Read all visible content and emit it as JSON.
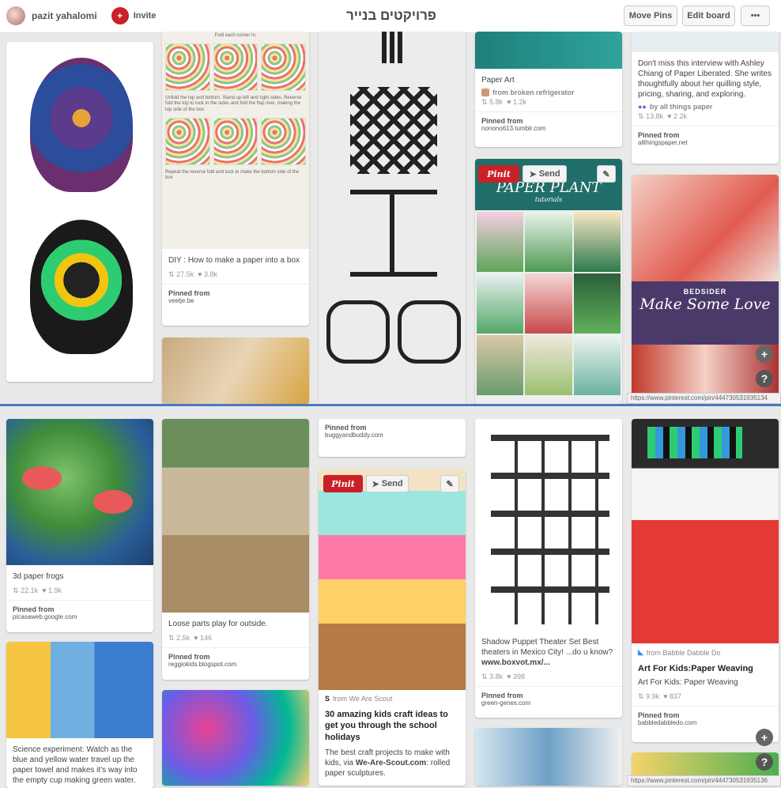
{
  "header": {
    "username": "pazit yahalomi",
    "invite_label": "Invite",
    "board_title": "פרויקטים בנייר",
    "move_pins_label": "Move Pins",
    "edit_board_label": "Edit board",
    "more_label": "•••"
  },
  "pins": [
    {
      "desc": "DIY : How to make a paper into a box",
      "repins": "27.5k",
      "likes": "3.8k",
      "from_label": "Pinned from",
      "source": "veetje.be",
      "fold1": "Fold each corner in.",
      "fold2": "Unfold the top and bottom. Stand up left and right sides. Reverse fold the top to tuck in the sides and fold the flap over, making the top side of the box",
      "fold3": "Repeat the reverse fold and tuck to make the bottom side of the box"
    },
    {
      "desc": "Paper Art",
      "attrib": "from broken refrigerator",
      "repins": "5.8k",
      "likes": "1.2k",
      "from_label": "Pinned from",
      "source": "nonono613.tumblr.com"
    },
    {
      "desc": "Don't miss this interview with Ashley Chiang of Paper Liberated. She writes thoughtfully about her quilling style, pricing, sharing, and exploring.",
      "attrib": "by all things paper",
      "repins": "13.8k",
      "likes": "2.2k",
      "from_label": "Pinned from",
      "source": "allthingspaper.net"
    },
    {
      "pinit": "Pinit",
      "send": "Send",
      "banner": "PAPER PLANT",
      "banner_sub": "tutorials"
    },
    {
      "banner_top": "BEDSIDER",
      "banner": "Make Some Love"
    },
    {
      "desc": "3d paper frogs",
      "repins": "22.1k",
      "likes": "1.9k",
      "from_label": "Pinned from",
      "source": "picasaweb.google.com"
    },
    {
      "desc": "Loose parts play for outside.",
      "repins": "2.5k",
      "likes": "146",
      "from_label": "Pinned from",
      "source": "reggiokids.blogspot.com"
    },
    {
      "from_label": "Pinned from",
      "source": "buggyandbuddy.com"
    },
    {
      "pinit": "Pinit",
      "send": "Send",
      "attrib": "from We Are Scout",
      "title": "30 amazing kids craft ideas to get you through the school holidays",
      "desc_pre": "The best craft projects to make with kids, via ",
      "desc_bold": "We-Are-Scout.com",
      "desc_post": ": rolled paper sculptures."
    },
    {
      "desc_pre": "Shadow Puppet Theater Set Best theaters in Mexico City! ...do u know? ",
      "desc_bold": "www.boxvot.mx/...",
      "repins": "3.8k",
      "likes": "398",
      "from_label": "Pinned from",
      "source": "green-genes.com"
    },
    {
      "attrib": "from Babble Dabble Do",
      "title": "Art For Kids:Paper Weaving",
      "desc": "Art For Kids: Paper Weaving",
      "repins": "9.9k",
      "likes": "837",
      "from_label": "Pinned from",
      "source": "babbledabbledo.com"
    },
    {
      "desc": "Science experiment: Watch as the blue and yellow water travel up the paper towel and makes it's way into the empty cup making green water."
    }
  ],
  "status_url_1": "https://www.pinterest.com/pin/444730531935134",
  "status_url_2": "https://www.pinterest.com/pin/444730531935136",
  "fab_plus": "+",
  "fab_help": "?",
  "repin_icon": "⇅",
  "like_icon": "♥",
  "colors": {
    "brand": "#cb2027",
    "divider": "#4a78c5"
  }
}
